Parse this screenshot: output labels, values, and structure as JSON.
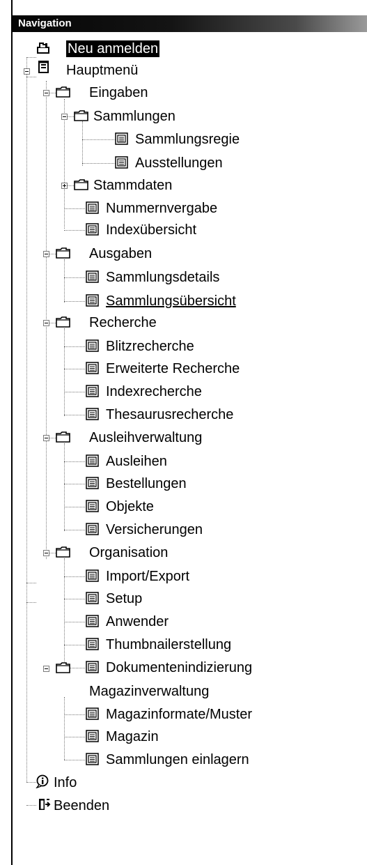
{
  "panel": {
    "title": "Navigation"
  },
  "tree": {
    "neu_anmelden": "Neu anmelden",
    "hauptmenu": "Hauptmenü",
    "eingaben": "Eingaben",
    "sammlungen": "Sammlungen",
    "sammlungsregie": "Sammlungsregie",
    "ausstellungen": "Ausstellungen",
    "stammdaten": "Stammdaten",
    "nummernvergabe": "Nummernvergabe",
    "indexuebersicht": "Indexübersicht",
    "ausgaben": "Ausgaben",
    "sammlungsdetails": "Sammlungsdetails",
    "sammlungsuebersicht": "Sammlungsübersicht",
    "recherche": "Recherche",
    "blitzrecherche": "Blitzrecherche",
    "erweiterte_recherche": "Erweiterte Recherche",
    "indexrecherche": "Indexrecherche",
    "thesaurusrecherche": "Thesaurusrecherche",
    "ausleihverwaltung": "Ausleihverwaltung",
    "ausleihen": "Ausleihen",
    "bestellungen": "Bestellungen",
    "objekte": "Objekte",
    "versicherungen": "Versicherungen",
    "organisation": "Organisation",
    "import_export": "Import/Export",
    "setup": "Setup",
    "anwender": "Anwender",
    "thumbnailerstellung": "Thumbnailerstellung",
    "dokumentenindizierung": "Dokumentenindizierung",
    "magazinverwaltung": "Magazinverwaltung",
    "magazinformate": "Magazinformate/Muster",
    "magazin": "Magazin",
    "sammlungen_einlagern": "Sammlungen einlagern",
    "info": "Info",
    "beenden": "Beenden"
  }
}
